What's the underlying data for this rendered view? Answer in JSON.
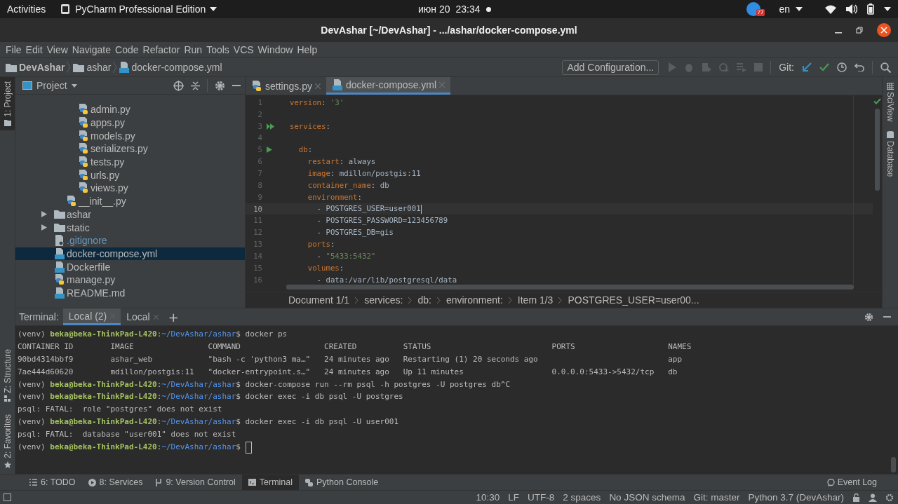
{
  "top_bar": {
    "activities": "Activities",
    "app_menu": "PyCharm Professional Edition",
    "date": "июн 20",
    "time": "23:34",
    "notification_count": "77",
    "language": "en"
  },
  "window": {
    "title": "DevAshar [~/DevAshar] - .../ashar/docker-compose.yml"
  },
  "menu": [
    "File",
    "Edit",
    "View",
    "Navigate",
    "Code",
    "Refactor",
    "Run",
    "Tools",
    "VCS",
    "Window",
    "Help"
  ],
  "nav": {
    "breadcrumbs": [
      {
        "label": "DevAshar",
        "kind": "root"
      },
      {
        "label": "ashar",
        "kind": "folder"
      },
      {
        "label": "docker-compose.yml",
        "kind": "compose"
      }
    ],
    "run_config": "Add Configuration...",
    "git_label": "Git:"
  },
  "left_strip_top": [
    {
      "label": "1: Project",
      "selected": true
    }
  ],
  "left_strip_bottom": [
    {
      "label": "Z: Structure",
      "selected": false
    },
    {
      "label": "2: Favorites",
      "selected": false
    }
  ],
  "project": {
    "title": "Project",
    "tree": [
      {
        "children": [
          {
            "children": [
              {
                "name": "admin.py",
                "kind": "py",
                "selected": false
              },
              {
                "name": "apps.py",
                "kind": "py",
                "selected": false
              },
              {
                "name": "models.py",
                "kind": "py",
                "selected": false
              },
              {
                "name": "serializers.py",
                "kind": "py",
                "selected": false
              },
              {
                "name": "tests.py",
                "kind": "py",
                "selected": false
              },
              {
                "name": "urls.py",
                "kind": "py",
                "selected": false
              },
              {
                "name": "views.py",
                "kind": "py",
                "selected": false
              }
            ]
          },
          {
            "name": "__init__.py",
            "kind": "py",
            "selected": false
          }
        ]
      },
      {
        "name": "ashar",
        "kind": "folder",
        "selected": false,
        "expanded": false
      },
      {
        "name": "static",
        "kind": "folder",
        "selected": false,
        "expanded": false
      },
      {
        "name": ".gitignore",
        "kind": "ignored",
        "selected": false
      },
      {
        "name": "docker-compose.yml",
        "kind": "compose",
        "selected": true
      },
      {
        "name": "Dockerfile",
        "kind": "docker",
        "selected": false
      },
      {
        "name": "manage.py",
        "kind": "py",
        "selected": false
      },
      {
        "name": "README.md",
        "kind": "md",
        "selected": false
      }
    ]
  },
  "editor": {
    "tabs": [
      {
        "label": "settings.py",
        "kind": "py",
        "selected": false
      },
      {
        "label": "docker-compose.yml",
        "kind": "compose",
        "selected": true
      }
    ],
    "lines": [
      {
        "number": "1",
        "current": false,
        "kind": "plain",
        "tokens": [
          {
            "text": "version",
            "kind": "key"
          },
          {
            "text": ": ",
            "kind": "plain"
          },
          {
            "text": "'3'",
            "kind": "string"
          }
        ]
      },
      {
        "number": "2",
        "current": false,
        "kind": "plain"
      },
      {
        "number": "3",
        "current": false,
        "kind": "run_all",
        "tokens": [
          {
            "text": "services",
            "kind": "key"
          },
          {
            "text": ":",
            "kind": "plain"
          }
        ]
      },
      {
        "number": "4",
        "current": false,
        "kind": "plain"
      },
      {
        "number": "5",
        "current": false,
        "kind": "run",
        "tokens": [
          {
            "text": "  db",
            "kind": "key"
          },
          {
            "text": ":",
            "kind": "plain"
          }
        ]
      },
      {
        "number": "6",
        "current": false,
        "kind": "plain",
        "tokens": [
          {
            "text": "    restart",
            "kind": "key"
          },
          {
            "text": ": always",
            "kind": "plain"
          }
        ]
      },
      {
        "number": "7",
        "current": false,
        "kind": "plain",
        "tokens": [
          {
            "text": "    image",
            "kind": "key"
          },
          {
            "text": ": mdillon/postgis:11",
            "kind": "plain"
          }
        ]
      },
      {
        "number": "8",
        "current": false,
        "kind": "plain",
        "tokens": [
          {
            "text": "    container_name",
            "kind": "key"
          },
          {
            "text": ": db",
            "kind": "plain"
          }
        ]
      },
      {
        "number": "9",
        "current": false,
        "kind": "plain",
        "tokens": [
          {
            "text": "    environment",
            "kind": "key"
          },
          {
            "text": ":",
            "kind": "plain"
          }
        ]
      },
      {
        "number": "10",
        "current": true,
        "kind": "plain",
        "tokens": [
          {
            "text": "      - POSTGRES_USER=user001",
            "kind": "plain"
          }
        ]
      },
      {
        "number": "11",
        "current": false,
        "kind": "plain",
        "tokens": [
          {
            "text": "      - POSTGRES_PASSWORD=123456789",
            "kind": "plain"
          }
        ]
      },
      {
        "number": "12",
        "current": false,
        "kind": "plain",
        "tokens": [
          {
            "text": "      - POSTGRES_DB=gis",
            "kind": "plain"
          }
        ]
      },
      {
        "number": "13",
        "current": false,
        "kind": "plain",
        "tokens": [
          {
            "text": "    ports",
            "kind": "key"
          },
          {
            "text": ":",
            "kind": "plain"
          }
        ]
      },
      {
        "number": "14",
        "current": false,
        "kind": "plain",
        "tokens": [
          {
            "text": "      - ",
            "kind": "plain"
          },
          {
            "text": "\"5433:5432\"",
            "kind": "string"
          }
        ]
      },
      {
        "number": "15",
        "current": false,
        "kind": "plain",
        "tokens": [
          {
            "text": "    volumes",
            "kind": "key"
          },
          {
            "text": ":",
            "kind": "plain"
          }
        ]
      },
      {
        "number": "16",
        "current": false,
        "kind": "plain",
        "tokens": [
          {
            "text": "      - data:/var/lib/postgresql/data",
            "kind": "plain"
          }
        ]
      }
    ],
    "breadcrumbs": [
      "Document 1/1",
      "services:",
      "db:",
      "environment:",
      "Item 1/3",
      "POSTGRES_USER=user00..."
    ]
  },
  "right_strip": [
    "SciView",
    "Database"
  ],
  "terminal": {
    "label": "Terminal:",
    "tabs": [
      {
        "label": "Local (2)",
        "selected": true
      },
      {
        "label": "Local",
        "selected": false
      }
    ],
    "new_tab": "+",
    "cursor": true,
    "lines": [
      [
        {
          "text": "(venv) ",
          "kind": "plain"
        },
        {
          "text": "beka@beka-ThinkPad-L420",
          "kind": "user"
        },
        {
          "text": ":",
          "kind": "plain"
        },
        {
          "text": "~/DevAshar/ashar",
          "kind": "path"
        },
        {
          "text": "$ docker ps",
          "kind": "plain"
        }
      ],
      [
        {
          "text": "CONTAINER ID        IMAGE                COMMAND                  CREATED          STATUS                          PORTS                    NAMES",
          "kind": "plain"
        }
      ],
      [
        {
          "text": "90bd4314bbf9        ashar_web            \"bash -c 'python3 ma…\"   24 minutes ago   Restarting (1) 20 seconds ago                            app",
          "kind": "plain"
        }
      ],
      [
        {
          "text": "7ae444d60620        mdillon/postgis:11   \"docker-entrypoint.s…\"   24 minutes ago   Up 11 minutes                   0.0.0.0:5433->5432/tcp   db",
          "kind": "plain"
        }
      ],
      [
        {
          "text": "(venv) ",
          "kind": "plain"
        },
        {
          "text": "beka@beka-ThinkPad-L420",
          "kind": "user"
        },
        {
          "text": ":",
          "kind": "plain"
        },
        {
          "text": "~/DevAshar/ashar",
          "kind": "path"
        },
        {
          "text": "$ docker-compose run --rm psql -h postgres -U postgres db^C",
          "kind": "plain"
        }
      ],
      [
        {
          "text": "(venv) ",
          "kind": "plain"
        },
        {
          "text": "beka@beka-ThinkPad-L420",
          "kind": "user"
        },
        {
          "text": ":",
          "kind": "plain"
        },
        {
          "text": "~/DevAshar/ashar",
          "kind": "path"
        },
        {
          "text": "$ docker exec -i db psql -U postgres",
          "kind": "plain"
        }
      ],
      [
        {
          "text": "psql: FATAL:  role \"postgres\" does not exist",
          "kind": "plain"
        }
      ],
      [
        {
          "text": "(venv) ",
          "kind": "plain"
        },
        {
          "text": "beka@beka-ThinkPad-L420",
          "kind": "user"
        },
        {
          "text": ":",
          "kind": "plain"
        },
        {
          "text": "~/DevAshar/ashar",
          "kind": "path"
        },
        {
          "text": "$ docker exec -i db psql -U user001",
          "kind": "plain"
        }
      ],
      [
        {
          "text": "psql: FATAL:  database \"user001\" does not exist",
          "kind": "plain"
        }
      ],
      [
        {
          "text": "(venv) ",
          "kind": "plain"
        },
        {
          "text": "beka@beka-ThinkPad-L420",
          "kind": "user"
        },
        {
          "text": ":",
          "kind": "plain"
        },
        {
          "text": "~/DevAshar/ashar",
          "kind": "path"
        },
        {
          "text": "$ ",
          "kind": "plain"
        }
      ]
    ]
  },
  "tool_tabs": [
    {
      "label": "6: TODO",
      "kind": "todo",
      "selected": false
    },
    {
      "label": "8: Services",
      "kind": "services",
      "selected": false
    },
    {
      "label": "9: Version Control",
      "kind": "vcs",
      "selected": false
    },
    {
      "label": "Terminal",
      "kind": "terminal",
      "selected": true
    },
    {
      "label": "Python Console",
      "kind": "console",
      "selected": false
    }
  ],
  "event_log": "Event Log",
  "status_bar": [
    "10:30",
    "LF",
    "UTF-8",
    "2 spaces",
    "No JSON schema",
    "Git: master",
    "Python 3.7 (DevAshar)"
  ]
}
